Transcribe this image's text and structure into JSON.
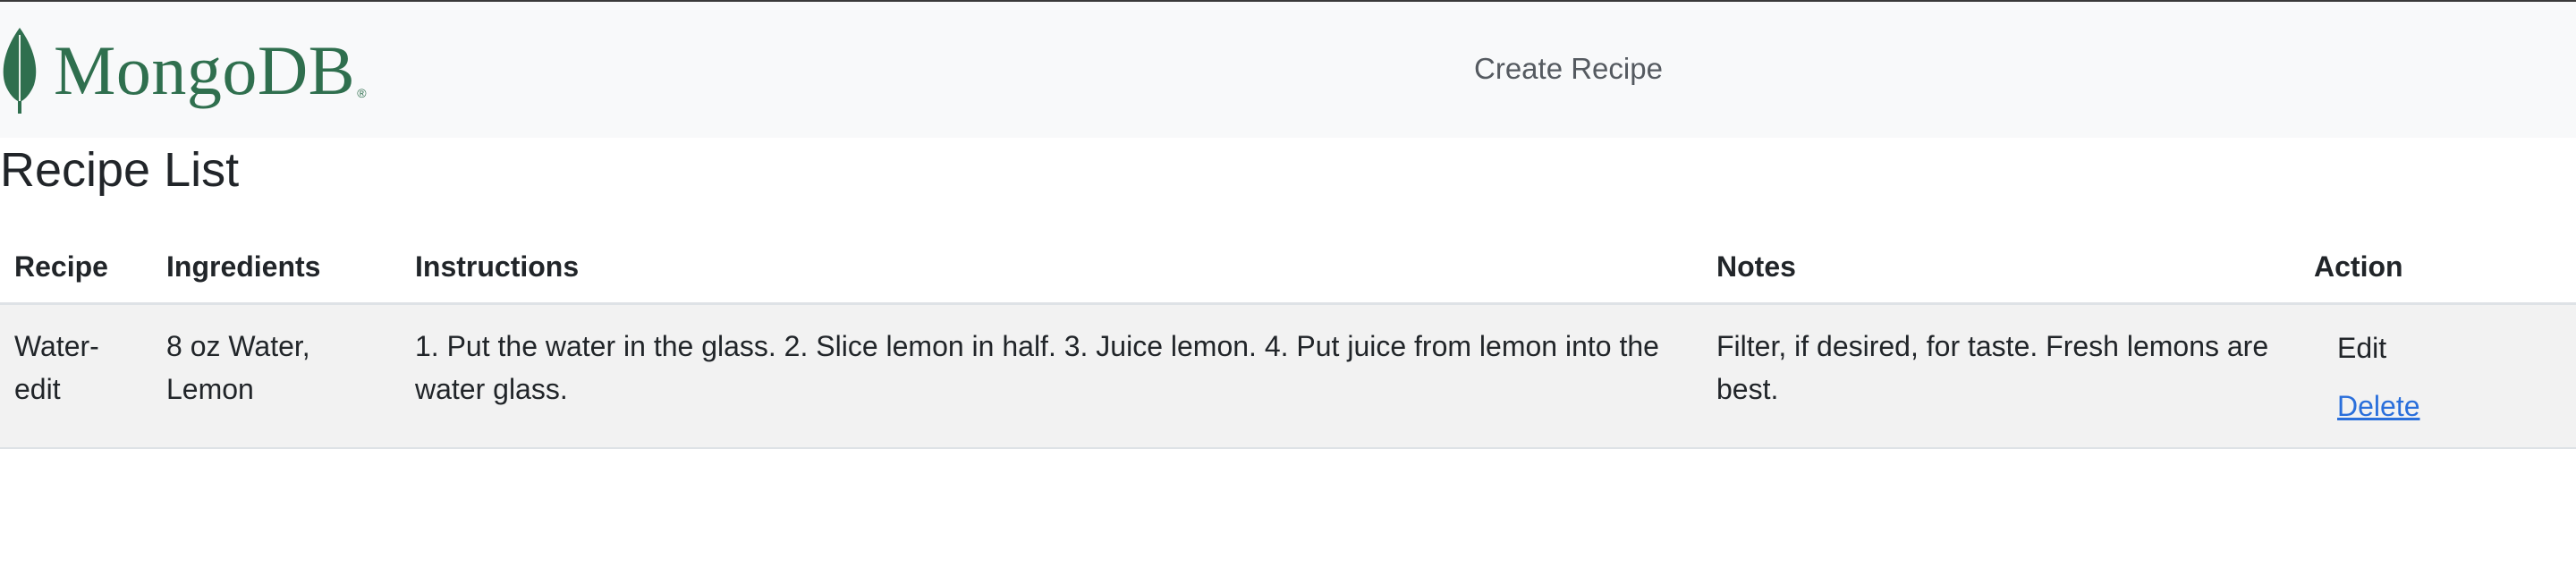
{
  "navbar": {
    "logo_text": "MongoDB",
    "logo_reg": "®",
    "create_recipe_link": "Create Recipe",
    "brand_color": "#2f6f4e"
  },
  "page": {
    "title": "Recipe List"
  },
  "table": {
    "headers": {
      "recipe": "Recipe",
      "ingredients": "Ingredients",
      "instructions": "Instructions",
      "notes": "Notes",
      "action": "Action"
    },
    "rows": [
      {
        "recipe": "Water-edit",
        "ingredients": "8 oz Water, Lemon",
        "instructions": "1. Put the water in the glass. 2. Slice lemon in half. 3. Juice lemon. 4. Put juice from lemon into the water glass.",
        "notes": "Filter, if desired, for taste. Fresh lemons are best.",
        "edit_label": "Edit",
        "delete_label": "Delete"
      }
    ]
  },
  "icons": {
    "logo": "leaf-icon"
  },
  "colors": {
    "navbar_bg": "#f8f9fa",
    "row_bg": "#f2f2f2",
    "link": "#2a6fdb"
  }
}
